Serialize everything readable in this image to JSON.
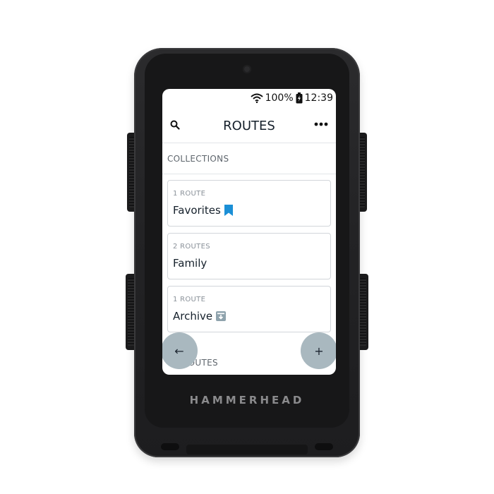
{
  "device": {
    "brand": "HAMMERHEAD"
  },
  "status_bar": {
    "battery": "100%",
    "time": "12:39",
    "icons": [
      "wifi-icon",
      "battery-charging-icon"
    ]
  },
  "header": {
    "title": "ROUTES",
    "left_icon": "search-icon",
    "right_icon": "more-icon"
  },
  "collections": {
    "label": "COLLECTIONS",
    "items": [
      {
        "count": "1 ROUTE",
        "name": "Favorites",
        "icon": "bookmark-icon",
        "icon_color": "#1b8fd6"
      },
      {
        "count": "2 ROUTES",
        "name": "Family"
      },
      {
        "count": "1 ROUTE",
        "name": "Archive",
        "icon": "archive-icon",
        "icon_color": "#8fa3ad"
      }
    ]
  },
  "routes_section": {
    "label": "ROUTES"
  },
  "fab": {
    "back_label": "←",
    "add_label": "+"
  },
  "colors": {
    "fab": "#a9b8bf",
    "accent": "#1b8fd6"
  }
}
